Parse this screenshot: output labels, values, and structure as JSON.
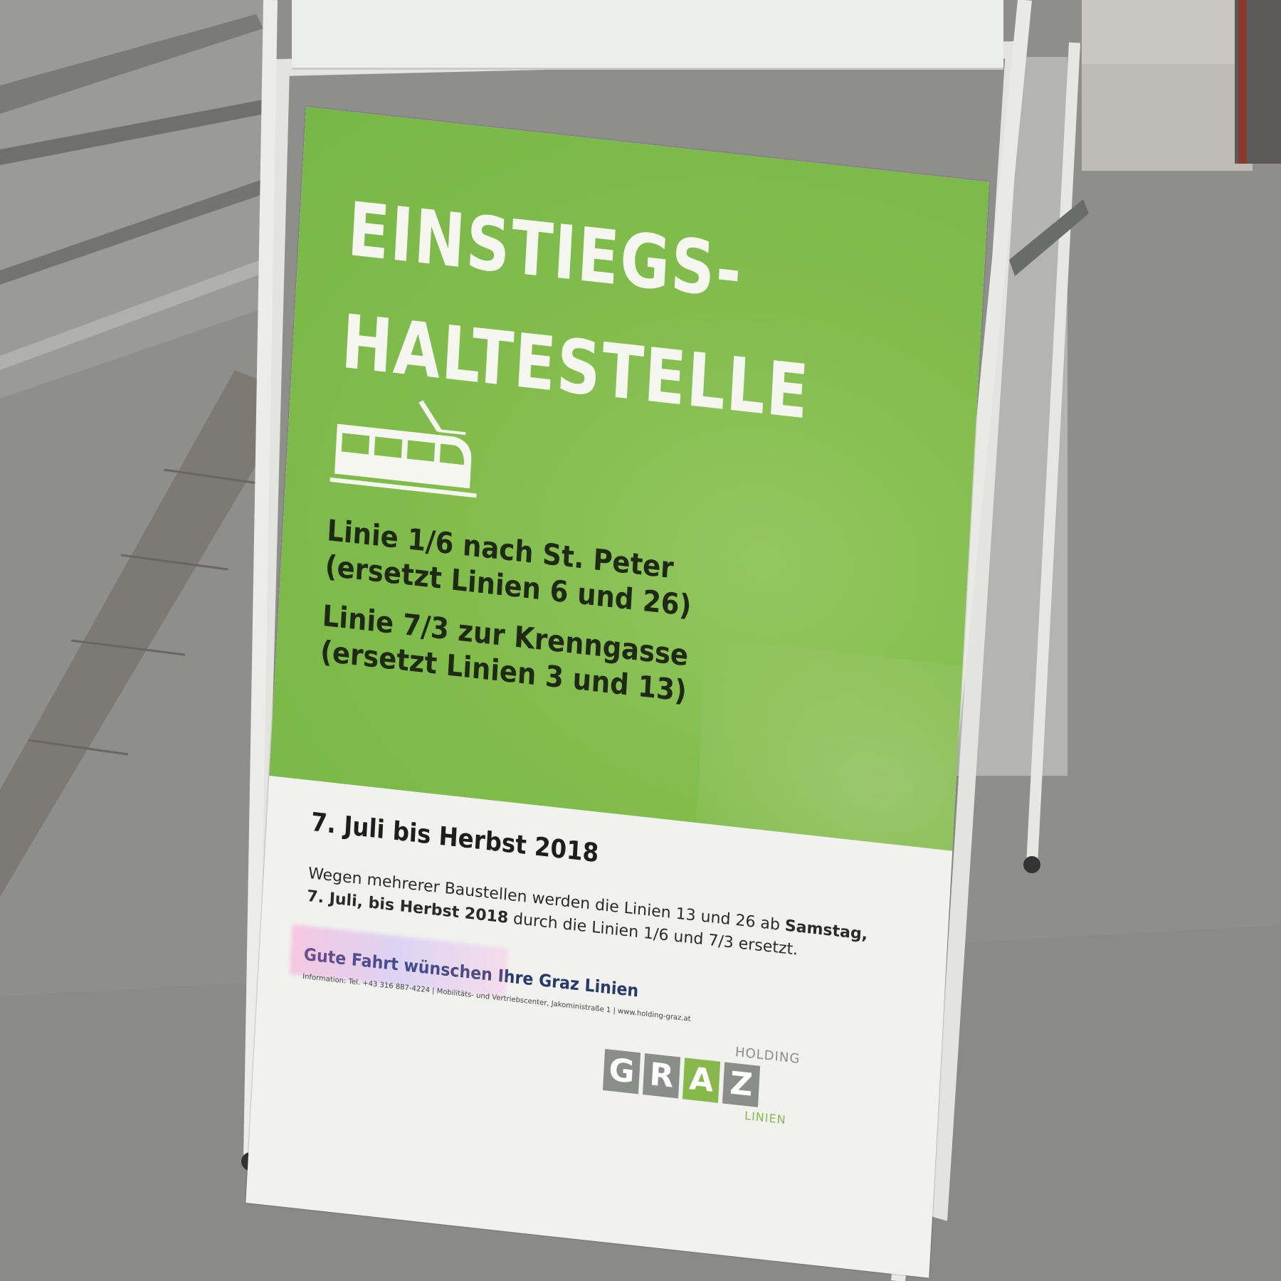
{
  "poster": {
    "headline_line1": "EINSTIEGS-",
    "headline_line2": "HALTESTELLE",
    "route1_line1": "Linie 1/6 nach St. Peter",
    "route1_line2": "(ersetzt Linien 6 und 26)",
    "route2_line1": "Linie 7/3 zur Krenngasse",
    "route2_line2": "(ersetzt Linien 3 und 13)",
    "date_range": "7. Juli bis Herbst 2018",
    "info_part1": "Wegen mehrerer Baustellen werden die Linien 13 und 26 ab ",
    "info_part1_bold": "Samstag,",
    "info_part2_bold": "7. Juli, bis Herbst 2018",
    "info_part2": " durch die Linien 1/6 und  7/3 ersetzt.",
    "greeting": "Gute Fahrt wünschen Ihre Graz Linien",
    "contact": "Information: Tel. +43 316 887-4224 | Mobilitäts- und Vertriebscenter, Jakoministraße 1 | www.holding-graz.at"
  },
  "logo": {
    "letters": [
      "G",
      "R",
      "A",
      "Z"
    ],
    "holding": "HOLDING",
    "linien": "LINIEN"
  },
  "colors": {
    "poster_green": "#82bd4c",
    "logo_grey": "#8b8d8b",
    "logo_green": "#86b84a"
  },
  "icons": {
    "tram": "tram-icon"
  }
}
